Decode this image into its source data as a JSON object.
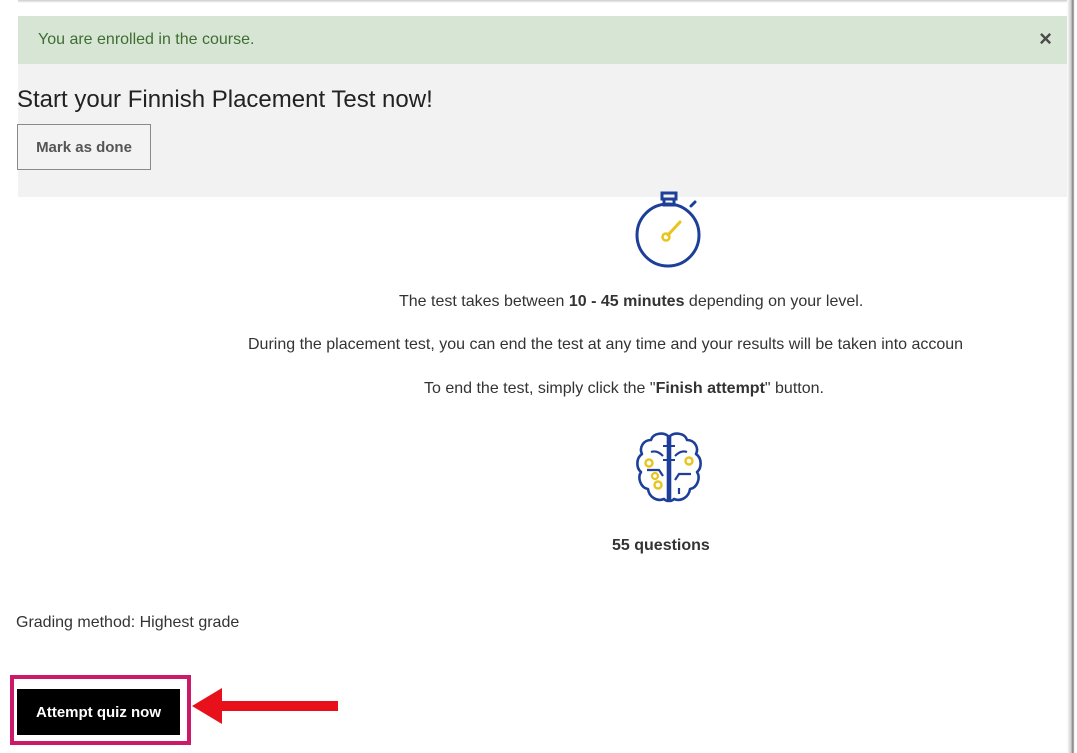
{
  "alert": {
    "message": "You are enrolled in the course.",
    "close_label": "×"
  },
  "header": {
    "title": "Start your Finnish Placement Test now!",
    "mark_done_label": "Mark as done"
  },
  "info": {
    "line1_prefix": "The test takes between ",
    "line1_bold": "10 - 45 minutes",
    "line1_suffix": " depending on your level.",
    "line2": "During the placement test, you can end the test at any time and your results will be taken into accoun",
    "line3_prefix": "To end the test, simply click the \"",
    "line3_bold": "Finish attempt",
    "line3_suffix": "\" button.",
    "questions": "55 questions"
  },
  "quiz": {
    "grading": "Grading method: Highest grade",
    "attempt_label": "Attempt quiz now"
  },
  "colors": {
    "alert_bg": "#d7e6d4",
    "alert_text": "#3f6d32",
    "icon_blue": "#1d3f9a",
    "icon_yellow": "#e8c41c",
    "highlight": "#cc1a6b",
    "arrow": "#e8101a"
  },
  "icons": {
    "stopwatch": "stopwatch-icon",
    "brain": "brain-icon",
    "arrow": "arrow-left-icon"
  }
}
